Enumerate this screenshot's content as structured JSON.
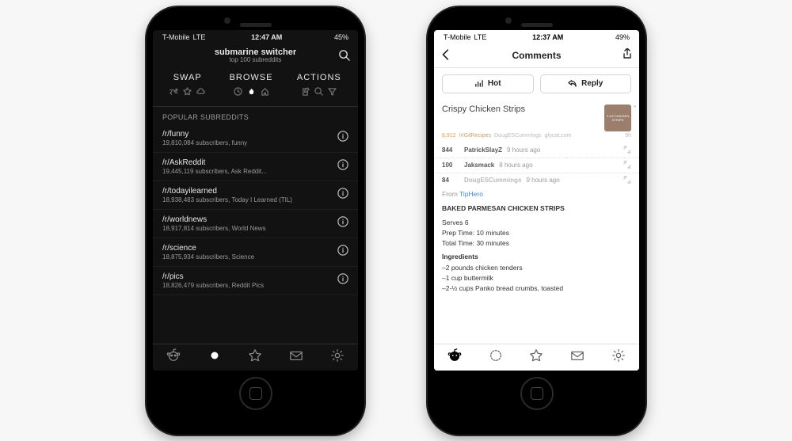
{
  "left": {
    "status": {
      "carrier": "T-Mobile",
      "net": "LTE",
      "time": "12:47 AM",
      "battery": "45%"
    },
    "header": {
      "title": "submarine switcher",
      "subtitle": "top 100 subreddits"
    },
    "tri": {
      "swap": "SWAP",
      "browse": "BROWSE",
      "actions": "ACTIONS"
    },
    "section": "POPULAR SUBREDDITS",
    "rows": [
      {
        "name": "/r/funny",
        "meta": "19,810,084 subscribers, funny"
      },
      {
        "name": "/r/AskReddit",
        "meta": "19,445,119 subscribers, Ask Reddit..."
      },
      {
        "name": "/r/todayilearned",
        "meta": "18,938,483 subscribers, Today I Learned (TIL)"
      },
      {
        "name": "/r/worldnews",
        "meta": "18,917,814 subscribers, World News"
      },
      {
        "name": "/r/science",
        "meta": "18,875,934 subscribers, Science"
      },
      {
        "name": "/r/pics",
        "meta": "18,826,479 subscribers, Reddit Pics"
      }
    ]
  },
  "right": {
    "status": {
      "carrier": "T-Mobile",
      "net": "LTE",
      "time": "12:37 AM",
      "battery": "49%"
    },
    "header": {
      "title": "Comments"
    },
    "pills": {
      "hot": "Hot",
      "reply": "Reply"
    },
    "post": {
      "title": "Crispy Chicken Strips",
      "score": "8,912",
      "subreddit": "/r/GifRecipes",
      "author": "DougESCummings",
      "domain": "gfycat.com",
      "age": "9h",
      "thumb": "2-1/2 CHICKEN STRIPS"
    },
    "stubs": [
      {
        "pts": "844",
        "user": "PatrickSlayZ",
        "age": "9 hours ago"
      },
      {
        "pts": "100",
        "user": "Jaksmack",
        "age": "8 hours ago"
      }
    ],
    "expanded": {
      "pts": "84",
      "user": "DougESCummings",
      "age": "9 hours ago",
      "from_label": "From ",
      "from_link": "TipHero",
      "recipe_title": "BAKED PARMESAN CHICKEN STRIPS",
      "serves": "Serves 6",
      "prep": "Prep Time: 10 minutes",
      "total": "Total Time: 30 minutes",
      "ing_hdr": "Ingredients",
      "ings": [
        "–2 pounds chicken tenders",
        "–1 cup buttermilk",
        "–2-½ cups Panko bread crumbs, toasted"
      ]
    }
  }
}
